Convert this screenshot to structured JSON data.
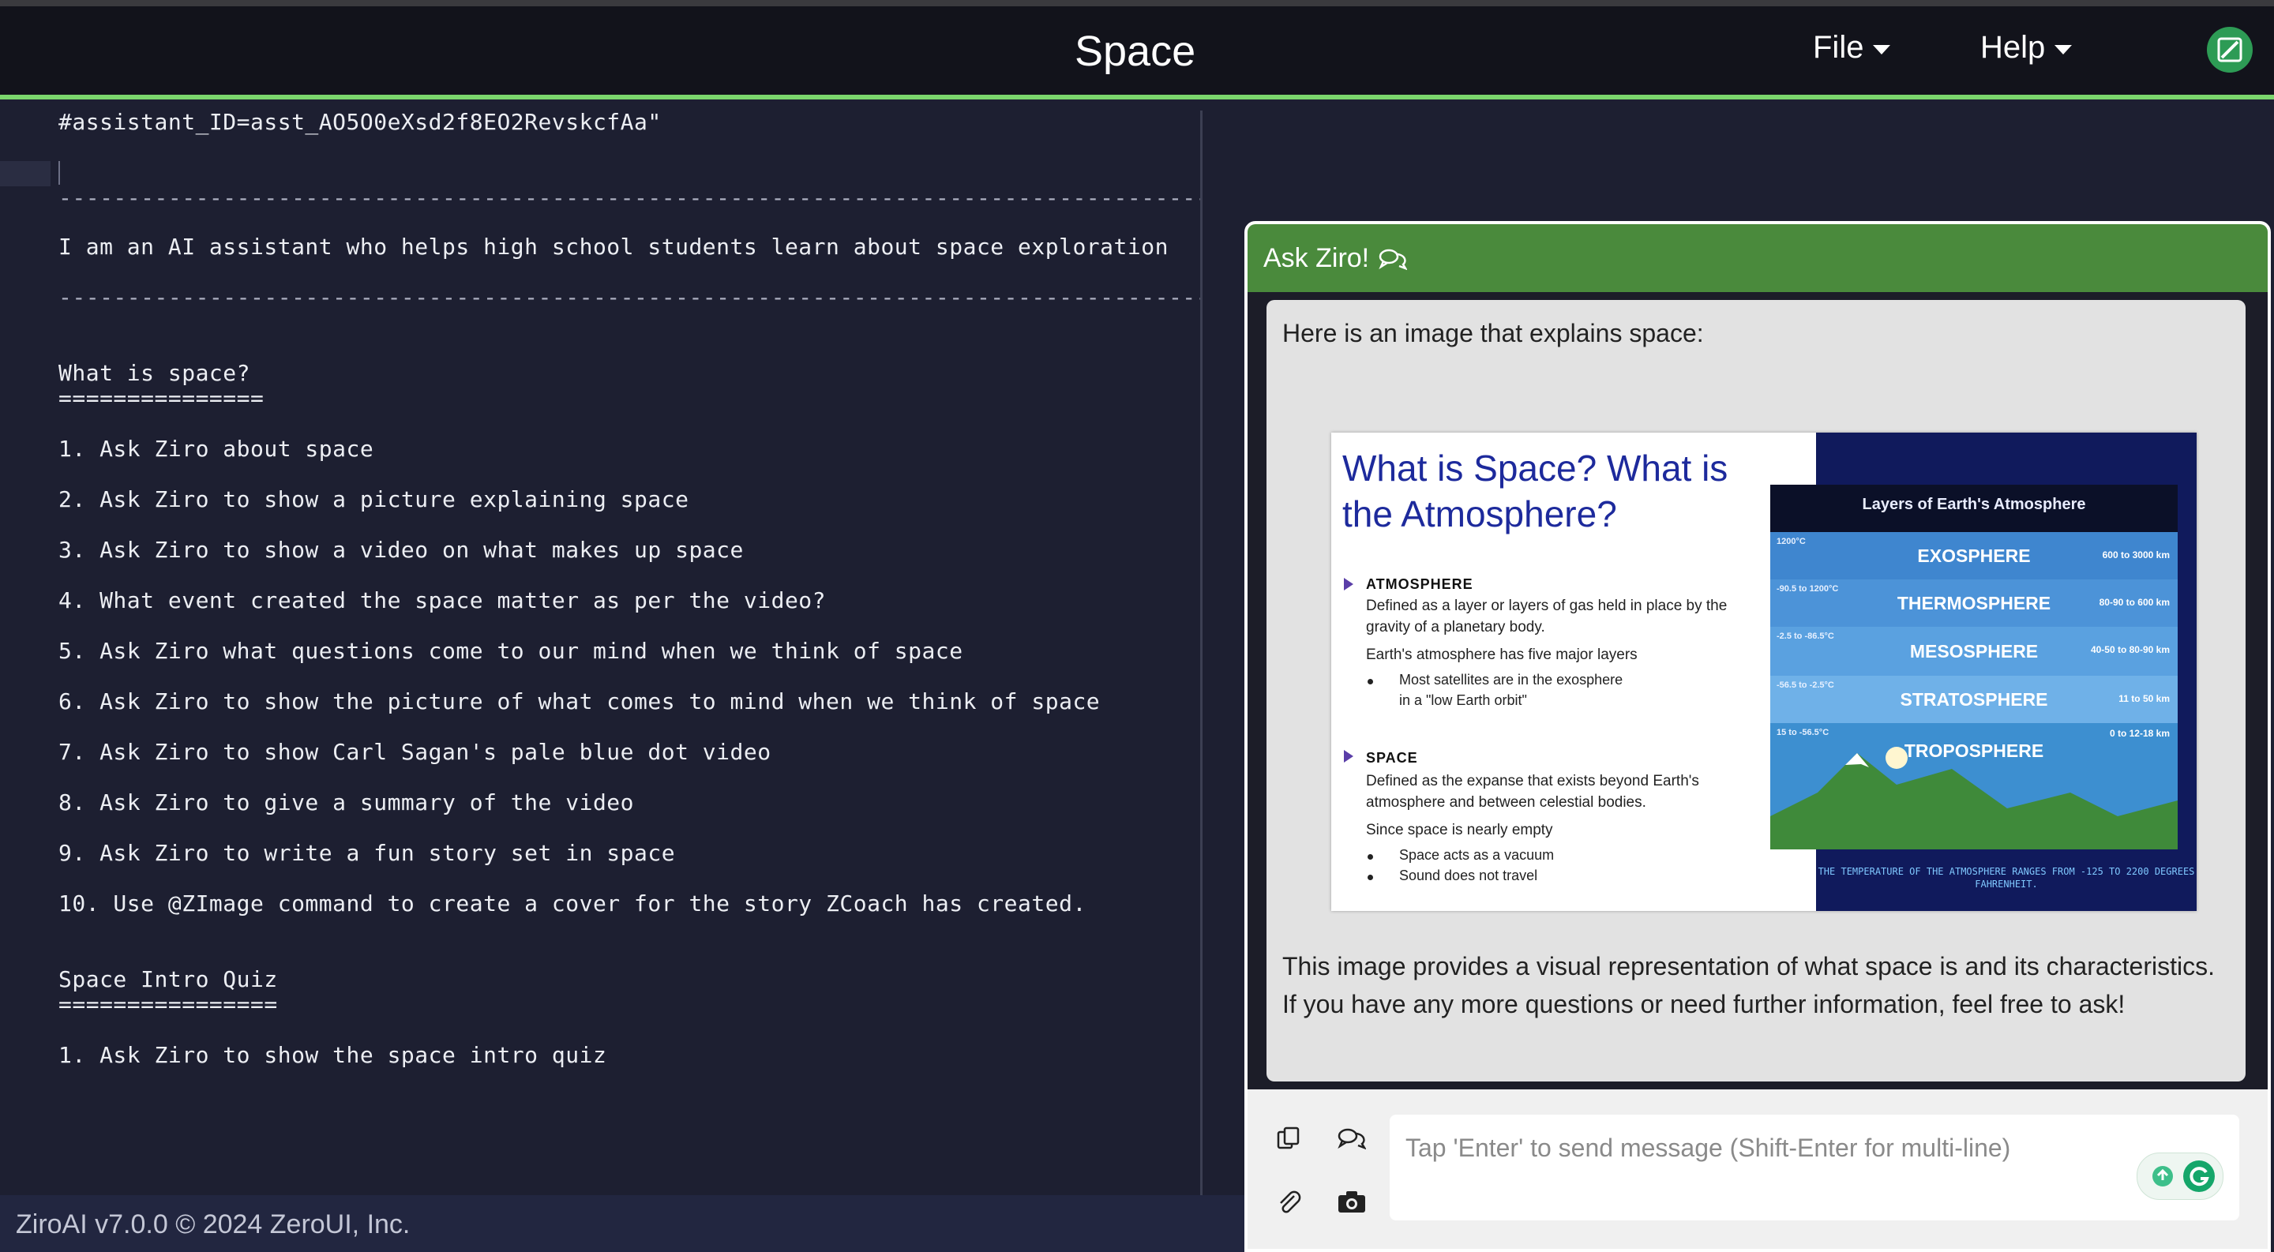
{
  "header": {
    "title": "Space",
    "menus": [
      "File",
      "Help"
    ]
  },
  "editor": {
    "assistant_line": "#assistant_ID=asst_AO5O0eXsd2f8EO2RevskcfAa\"",
    "separator": "------------------------------------------------------------------------------------------",
    "intro": "I am an AI assistant who helps high school students learn about space exploration",
    "section1_title": "What is space?",
    "section1_underline": "===============",
    "items": [
      "1. Ask Ziro about space",
      "2. Ask Ziro to show a picture explaining space",
      "3. Ask Ziro to show a video on what makes up space",
      "4. What event created the space matter as per the video?",
      "5. Ask Ziro what questions come to our mind when we think of space",
      "6. Ask Ziro to show the picture of what comes to mind when we think of space",
      "7. Ask Ziro to show Carl Sagan's pale blue dot video",
      "8. Ask Ziro to give a summary of the video",
      "9. Ask Ziro to write a fun story set in space",
      "10. Use @ZImage command to create a cover for the story ZCoach has created."
    ],
    "section2_title": "Space Intro Quiz",
    "section2_underline": "================",
    "quiz_items": [
      "1. Ask Ziro to show the space intro quiz"
    ]
  },
  "footer": {
    "text": "ZiroAI v7.0.0 © 2024 ZeroUI, Inc."
  },
  "chat": {
    "title": "Ask Ziro!",
    "message_intro": "Here is an image that explains space:",
    "message_body": "This image provides a visual representation of what space is and its characteristics. If you have any more questions or need further information, feel free to ask!",
    "input_placeholder": "Tap 'Enter' to send message (Shift-Enter for multi-line)"
  },
  "slide": {
    "title": "What is Space? What is the Atmosphere?",
    "atmosphere_heading": "ATMOSPHERE",
    "atmosphere_def": "Defined as a layer or layers of gas held in place by the gravity of a planetary body.",
    "atmosphere_layers": "Earth's atmosphere has five major layers",
    "atmosphere_bullet": "Most satellites are in the exosphere in a \"low Earth orbit\"",
    "space_heading": "SPACE",
    "space_def": "Defined as the expanse that exists beyond Earth's atmosphere and between celestial bodies.",
    "space_empty": "Since space is nearly empty",
    "space_bullets": [
      "Space acts as a vacuum",
      "Sound does not travel"
    ],
    "diagram_title": "Layers of Earth's Atmosphere",
    "layers": [
      {
        "name": "EXOSPHERE",
        "temp": "1200°C",
        "alt": "600 to 3000 km",
        "color": "#3f86cf"
      },
      {
        "name": "THERMOSPHERE",
        "temp": "-90.5 to 1200°C",
        "alt": "80-90 to 600 km",
        "color": "#4c93d8"
      },
      {
        "name": "MESOSPHERE",
        "temp": "-2.5 to -86.5°C",
        "alt": "40-50 to 80-90 km",
        "color": "#5aa1e0"
      },
      {
        "name": "STRATOSPHERE",
        "temp": "-56.5 to -2.5°C",
        "alt": "11 to 50 km",
        "color": "#6fb1e8"
      },
      {
        "name": "TROPOSPHERE",
        "temp": "15 to -56.5°C",
        "alt": "0 to 12-18 km",
        "color": "#3d8fd0"
      }
    ],
    "footnote": "THE TEMPERATURE OF THE ATMOSPHERE RANGES FROM -125 TO 2200 DEGREES FAHRENHEIT."
  },
  "colors": {
    "header_accent": "#7bd66d",
    "chat_header": "#4a8a3c",
    "editor_bg": "#1d1f31"
  },
  "icons": [
    "chevron-down-icon",
    "ziro-logo-icon",
    "chat-bubbles-icon",
    "copy-icon",
    "paperclip-icon",
    "camera-icon",
    "grammarly-icon"
  ]
}
